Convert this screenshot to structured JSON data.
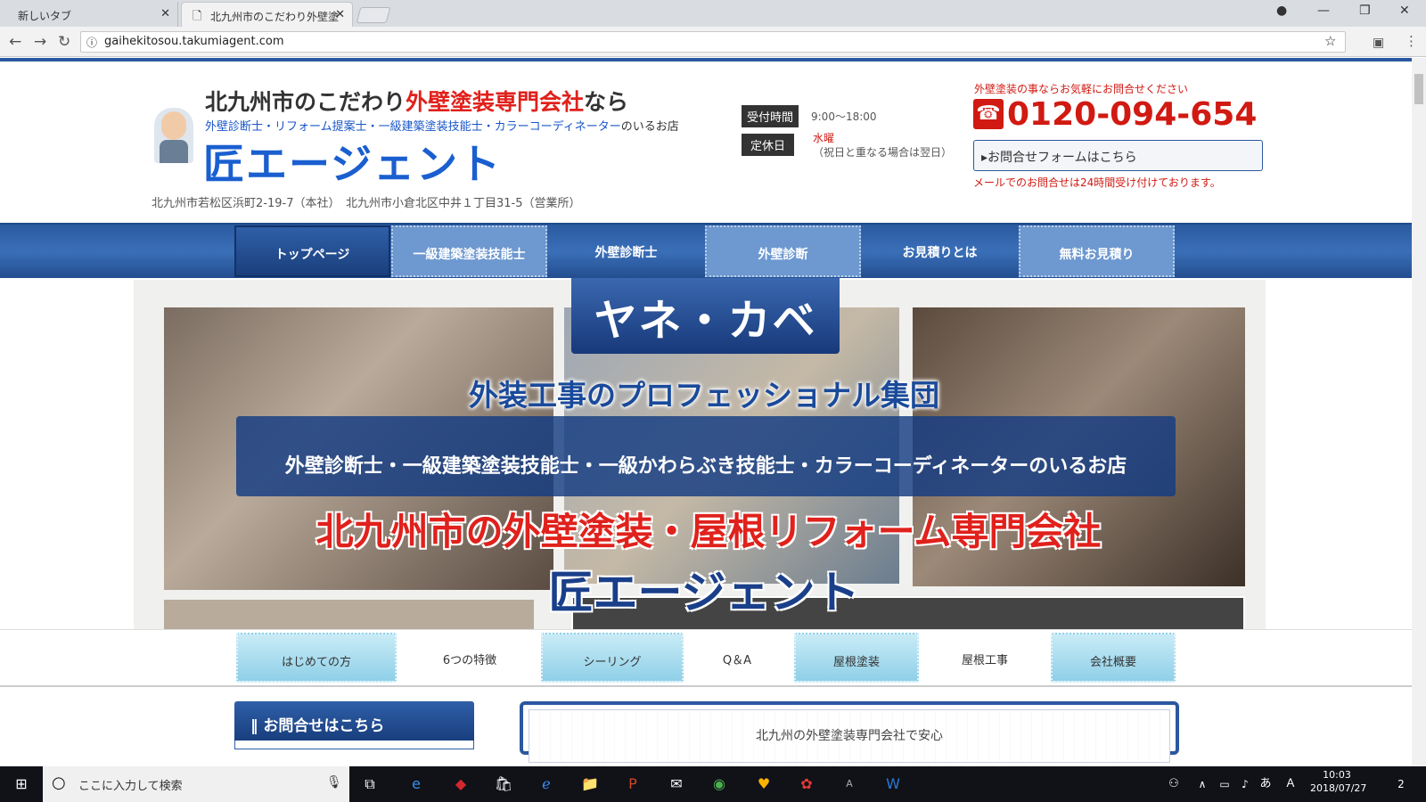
{
  "browser": {
    "tabs": [
      {
        "label": "新しいタブ"
      },
      {
        "label": "北九州市のこだわり外壁塗"
      }
    ],
    "url": "gaihekitosou.takumiagent.com"
  },
  "header": {
    "title_pre": "北九州市のこだわり",
    "title_red": "外壁塗装専門会社",
    "title_post": "なら",
    "sub_blue": "外壁診断士・リフォーム提案士・一級建築塗装技能士・カラーコーディネーター",
    "sub_post": "のいるお店",
    "logo": "匠エージェント",
    "address": "北九州市若松区浜町2-19-7（本社）　北九州市小倉北区中井１丁目31-5（営業所）",
    "hours_label": "受付時間",
    "hours": "9:00～18:00",
    "holiday_label": "定休日",
    "holiday": "水曜",
    "holiday_note": "（祝日と重なる場合は翌日）",
    "contact_lead": "外壁塗装の事ならお気軽にお問合せください",
    "phone": "0120-094-654",
    "form_button": "お問合せフォームはこちら",
    "mail_note": "メールでのお問合せは24時間受け付けております。"
  },
  "nav1": [
    "トップページ",
    "一級建築塗装技能士",
    "外壁診断士",
    "外壁診断",
    "お見積りとは",
    "無料お見積り"
  ],
  "hero": {
    "yane": "ヤネ・カベ",
    "line1": "外装工事のプロフェッショナル集団",
    "band": "外壁診断士・一級建築塗装技能士・一級かわらぶき技能士・カラーコーディネーターのいるお店",
    "line2": "北九州市の外壁塗装・屋根リフォーム専門会社",
    "line3": "匠エージェント"
  },
  "nav2": [
    "はじめての方",
    "6つの特徴",
    "シーリング",
    "Q＆A",
    "屋根塗装",
    "屋根工事",
    "会社概要"
  ],
  "sidebar": {
    "title": "お問合せはこちら"
  },
  "main": {
    "text": "北九州の外壁塗装専門会社で安心"
  },
  "taskbar": {
    "search": "ここに入力して検索",
    "time": "10:03",
    "date": "2018/07/27",
    "notif": "2",
    "ime": "あ"
  }
}
